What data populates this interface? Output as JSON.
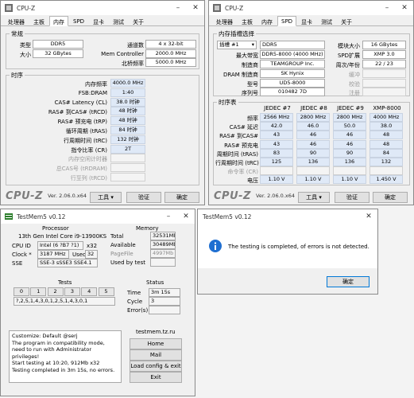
{
  "cpuz_left": {
    "title": "CPU-Z",
    "tabs": [
      "处理器",
      "主板",
      "内存",
      "SPD",
      "显卡",
      "测试",
      "关于"
    ],
    "general": {
      "legend": "常规",
      "type_label": "类型",
      "type_value": "DDR5",
      "size_label": "大小",
      "size_value": "32 GBytes",
      "channels_label": "通道数",
      "channels_value": "4 x 32-bit",
      "memctrl_label": "Mem Controller",
      "memctrl_value": "2000.0 MHz",
      "uncore_label": "北桥频率",
      "uncore_value": "5000.0 MHz"
    },
    "timings": {
      "legend": "时序",
      "rows": [
        {
          "label": "内存频率",
          "value": "4000.0 MHz",
          "gray": false
        },
        {
          "label": "FSB:DRAM",
          "value": "1:40",
          "gray": false
        },
        {
          "label": "CAS# Latency (CL)",
          "value": "38.0 时钟",
          "gray": false
        },
        {
          "label": "RAS# 到CAS# (tRCD)",
          "value": "48 时钟",
          "gray": false
        },
        {
          "label": "RAS# 预充电 (tRP)",
          "value": "48 时钟",
          "gray": false
        },
        {
          "label": "循环周期 (tRAS)",
          "value": "84 时钟",
          "gray": false
        },
        {
          "label": "行周期时间 (tRC)",
          "value": "132 时钟",
          "gray": false
        },
        {
          "label": "指令比率 (CR)",
          "value": "2T",
          "gray": false
        },
        {
          "label": "内存空闲计时器",
          "value": "",
          "gray": true
        },
        {
          "label": "总CAS号 (tRDRAM)",
          "value": "",
          "gray": true
        },
        {
          "label": "行至列 (tRCD)",
          "value": "",
          "gray": true
        }
      ]
    },
    "footer": {
      "brand": "CPU-Z",
      "version": "Ver. 2.06.0.x64",
      "tools": "工具",
      "validate": "验证",
      "ok": "确定"
    }
  },
  "cpuz_right": {
    "title": "CPU-Z",
    "tabs": [
      "处理器",
      "主板",
      "内存",
      "SPD",
      "显卡",
      "测试",
      "关于"
    ],
    "slot": {
      "legend": "内存插槽选择",
      "slot_value": "插槽 #1",
      "type_value": "DDR5",
      "module_size_label": "模块大小",
      "module_size_value": "16 GBytes",
      "max_bw_label": "最大带宽",
      "max_bw_value": "DDR5-8000 (4000 MHz)",
      "spd_ext_label": "SPD扩展",
      "spd_ext_value": "XMP 3.0",
      "mfr_label": "制造商",
      "mfr_value": "TEAMGROUP Inc.",
      "week_label": "周次/年份",
      "week_value": "22 / 23",
      "dram_mfr_label": "DRAM 制造商",
      "dram_mfr_value": "SK Hynix",
      "buffered_label": "缓冲",
      "part_label": "型号",
      "part_value": "UD5-8000",
      "correction_label": "校验",
      "serial_label": "序列号",
      "serial_value": "010482 7D",
      "registered_label": "注册"
    },
    "timing_table": {
      "legend": "时序表",
      "headers": [
        "JEDEC #7",
        "JEDEC #8",
        "JEDEC #9",
        "XMP-8000"
      ],
      "rows": [
        {
          "label": "频率",
          "cells": [
            "2566 MHz",
            "2800 MHz",
            "2800 MHz",
            "4000 MHz"
          ]
        },
        {
          "label": "CAS# 延迟",
          "cells": [
            "42.0",
            "46.0",
            "50.0",
            "38.0"
          ]
        },
        {
          "label": "RAS# 到CAS#",
          "cells": [
            "43",
            "46",
            "46",
            "48"
          ]
        },
        {
          "label": "RAS# 预充电",
          "cells": [
            "43",
            "46",
            "46",
            "48"
          ]
        },
        {
          "label": "周期时间 (tRAS)",
          "cells": [
            "83",
            "90",
            "90",
            "84"
          ]
        },
        {
          "label": "行周期时间 (tRC)",
          "cells": [
            "125",
            "136",
            "136",
            "132"
          ]
        },
        {
          "label": "命令率 (CR)",
          "cells": [
            "",
            "",
            "",
            ""
          ],
          "gray": true
        },
        {
          "label": "电压",
          "cells": [
            "1.10 V",
            "1.10 V",
            "1.10 V",
            "1.450 V"
          ]
        }
      ]
    },
    "footer": {
      "brand": "CPU-Z",
      "version": "Ver. 2.06.0.x64",
      "tools": "工具",
      "validate": "验证",
      "ok": "确定"
    }
  },
  "testmem": {
    "title": "TestMem5 v0.12",
    "processor_heading": "Processor",
    "processor_name": "13th Gen Intel Core i9-13900KS",
    "cpuid_label": "CPU ID",
    "cpuid_value": "Intel (6 ?B7 ?1)",
    "cpuid_bits": "x32",
    "clock_label": "Clock *",
    "clock_value": "3187 MHz",
    "used_label": "Used",
    "used_value": "32",
    "sse_label": "SSE",
    "sse_value": "SSE-3 sSSE3 SSE4.1",
    "memory_heading": "Memory",
    "total_label": "Total",
    "total_value": "32531Mb",
    "available_label": "Available",
    "available_value": "30489Mb",
    "pagefile_label": "PageFile",
    "pagefile_value": "4997Mb",
    "usedbytest_label": "Used by test",
    "usedbytest_value": "",
    "tests_heading": "Tests",
    "test_numbers": [
      "0",
      "1",
      "2",
      "3",
      "4",
      "5"
    ],
    "tests_sequence": "?,2,5,1,4,3,0,1,2,5,1,4,3,0,1",
    "status_heading": "Status",
    "time_label": "Time",
    "time_value": "3m 15s",
    "cycle_label": "Cycle",
    "cycle_value": "3",
    "errors_label": "Error(s)",
    "errors_value": "",
    "log_lines": [
      "Customize: Default @serj",
      "The program in compatibility mode,",
      "need to run with Administrator privileges!",
      "Start testing at 10:20, 912Mb x32",
      "Testing completed in 3m 15s, no errors."
    ],
    "site": "testmem.tz.ru",
    "home_btn": "Home",
    "mail_btn": "Mail",
    "load_btn": "Load config & exit",
    "exit_btn": "Exit"
  },
  "dialog": {
    "title": "TestMem5 v0.12",
    "message": "The testing is completed, of errors is not detected.",
    "ok": "确定"
  },
  "colors": {
    "value_blue": "#dfe9f7",
    "info_blue": "#1f6fd1",
    "border": "#8a8a8a"
  },
  "icons": {
    "cpuz": "cpuz-app-icon",
    "testmem": "testmem-app-icon",
    "info": "info-icon"
  }
}
